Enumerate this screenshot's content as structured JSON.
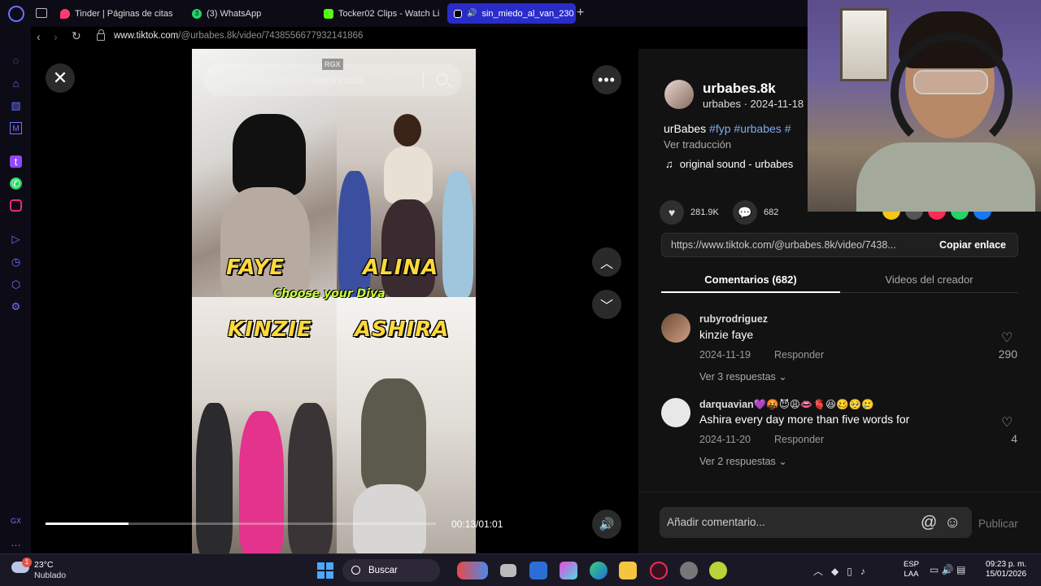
{
  "browser": {
    "tabs": [
      {
        "label": "Tinder | Páginas de citas",
        "icon": "tinder-flame-icon",
        "color": "#fe3c72"
      },
      {
        "label": "(3) WhatsApp",
        "icon": "whatsapp-icon",
        "color": "#25d366"
      },
      {
        "label": "Tocker02 Clips - Watch Li",
        "icon": "kick-icon",
        "color": "#53fc18"
      },
      {
        "label": "sin_miedo_al_van_230",
        "icon": "tiktok-icon",
        "color": "#ffffff"
      }
    ],
    "url_host": "www.tiktok.com",
    "url_path": "/@urbabes.8k/video/7438556677932141866"
  },
  "video": {
    "search_placeholder": "Buscar contenido relacionado",
    "watermark": "RGX",
    "overlay_names": [
      "FAYE",
      "ALINA",
      "KINZIE",
      "ASHIRA"
    ],
    "overlay_caption": "Choose your Diva",
    "time_display": "00:13/01:01",
    "progress_fraction": 0.213
  },
  "post": {
    "username": "urbabes.8k",
    "subline": "urbabes · 2024-11-18",
    "caption_prefix": "urBabes",
    "hashtags": [
      "#fyp",
      "#urbabes",
      "#"
    ],
    "translate_label": "Ver traducción",
    "sound": "original sound - urbabes",
    "likes": "281.9K",
    "comments_count": "682",
    "link": "https://www.tiktok.com/@urbabes.8k/video/7438...",
    "copy_label": "Copiar enlace",
    "tab_comments": "Comentarios (682)",
    "tab_creator": "Videos del creador"
  },
  "comments": [
    {
      "user": "rubyrodriguez",
      "text": "kinzie faye",
      "date": "2024-11-19",
      "reply": "Responder",
      "more": "Ver 3 respuestas",
      "likes": "290"
    },
    {
      "user": "darquavian💜🤬😈😩👄🫀😆🥴🥺🥲",
      "text": "Ashira every day more than five words for",
      "date": "2024-11-20",
      "reply": "Responder",
      "more": "Ver 2 respuestas",
      "likes": "4"
    }
  ],
  "comment_box": {
    "placeholder": "Añadir comentario...",
    "publish": "Publicar"
  },
  "taskbar": {
    "temp": "23°C",
    "condition": "Nublado",
    "badge": "1",
    "search": "Buscar",
    "lang1": "ESP",
    "lang2": "LAA",
    "time": "09:23 p. m.",
    "date": "15/01/2026"
  }
}
